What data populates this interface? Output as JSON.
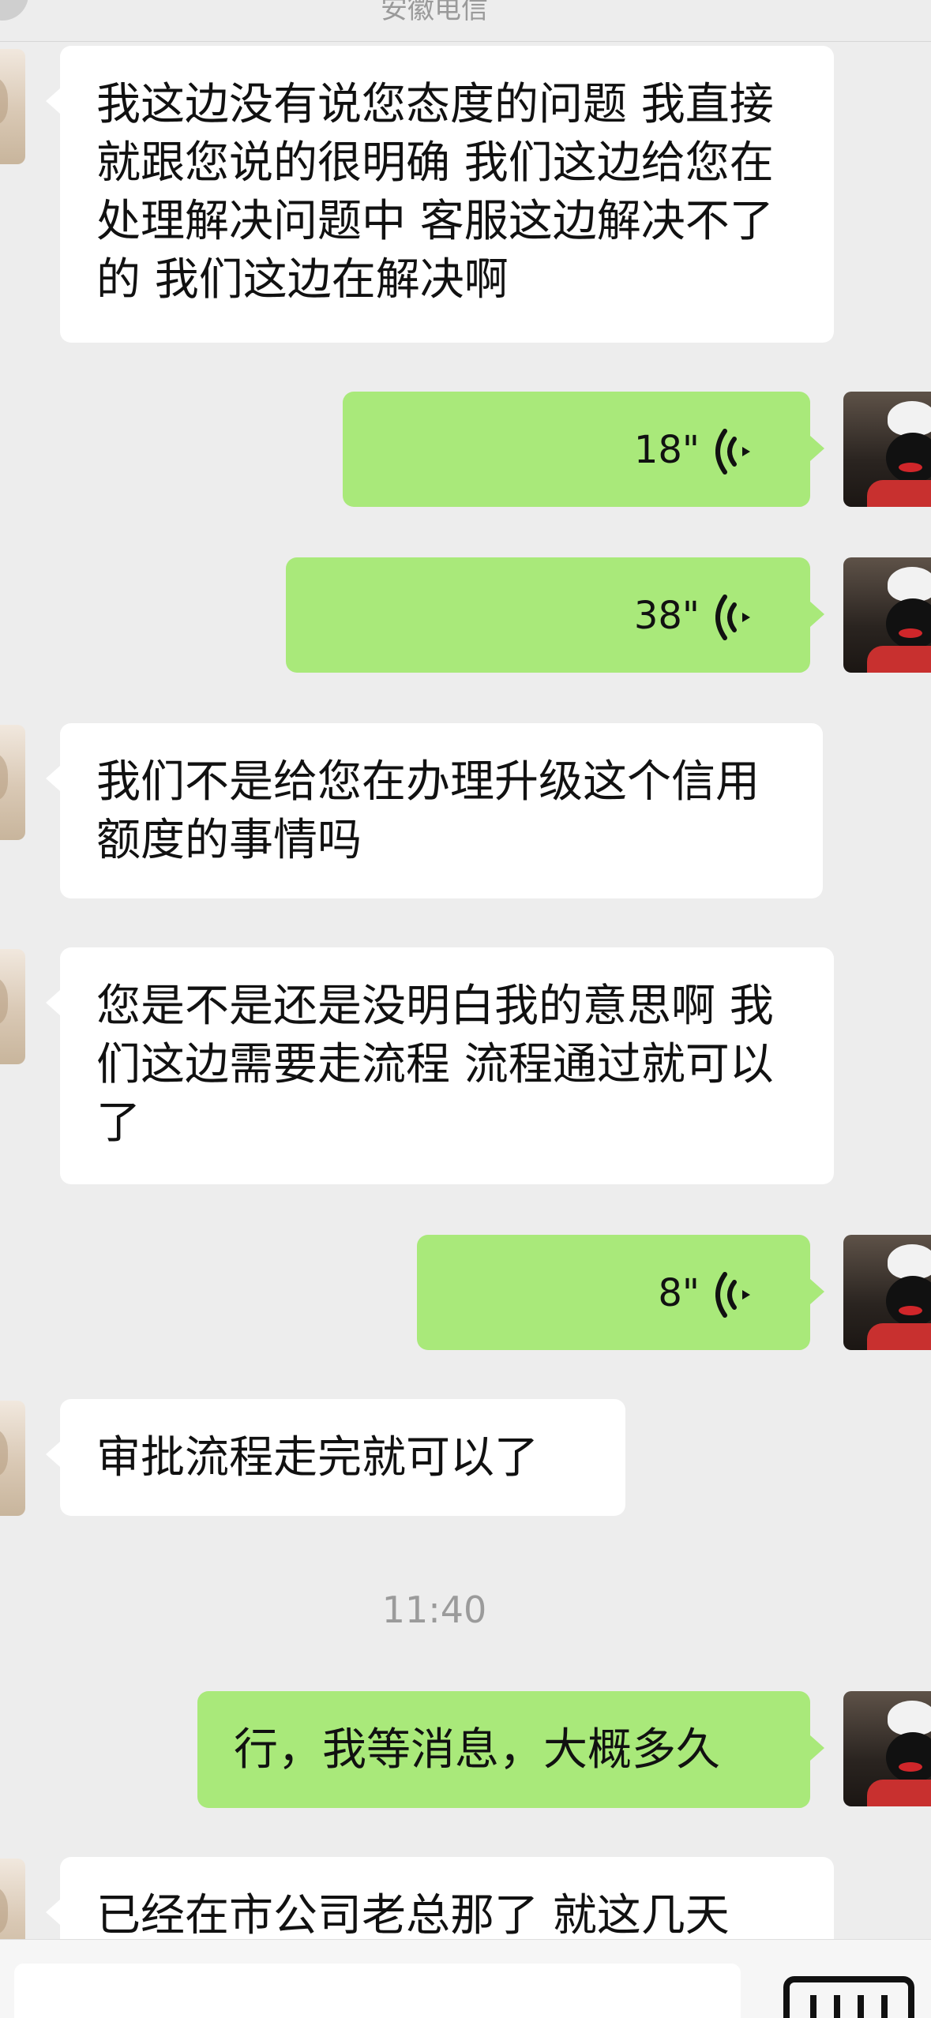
{
  "header": {
    "title": "安徽电信"
  },
  "messages": [
    {
      "type": "text",
      "side": "in",
      "text": "我这边没有说您态度的问题 我直接就跟您说的很明确 我们这边给您在处理解决问题中 客服这边解决不了的 我们这边在解决啊"
    },
    {
      "type": "voice",
      "side": "out",
      "duration": "18\""
    },
    {
      "type": "voice",
      "side": "out",
      "duration": "38\""
    },
    {
      "type": "text",
      "side": "in",
      "text": "我们不是给您在办理升级这个信用额度的事情吗"
    },
    {
      "type": "text",
      "side": "in",
      "text": "您是不是还是没明白我的意思啊 我们这边需要走流程 流程通过就可以了"
    },
    {
      "type": "voice",
      "side": "out",
      "duration": "8\""
    },
    {
      "type": "text",
      "side": "in",
      "text": "审批流程走完就可以了"
    },
    {
      "type": "timestamp",
      "text": "11:40"
    },
    {
      "type": "text",
      "side": "out",
      "text": "行，我等消息，大概多久"
    },
    {
      "type": "text",
      "side": "in",
      "text": "已经在市公司老总那了 就这几天"
    }
  ],
  "colors": {
    "background": "#ededed",
    "outgoing_bubble": "#a9e97a",
    "incoming_bubble": "#ffffff",
    "timestamp": "#9b9b9b"
  },
  "icons": {
    "voice": "voice-wave-icon",
    "keyboard": "keyboard-icon"
  }
}
